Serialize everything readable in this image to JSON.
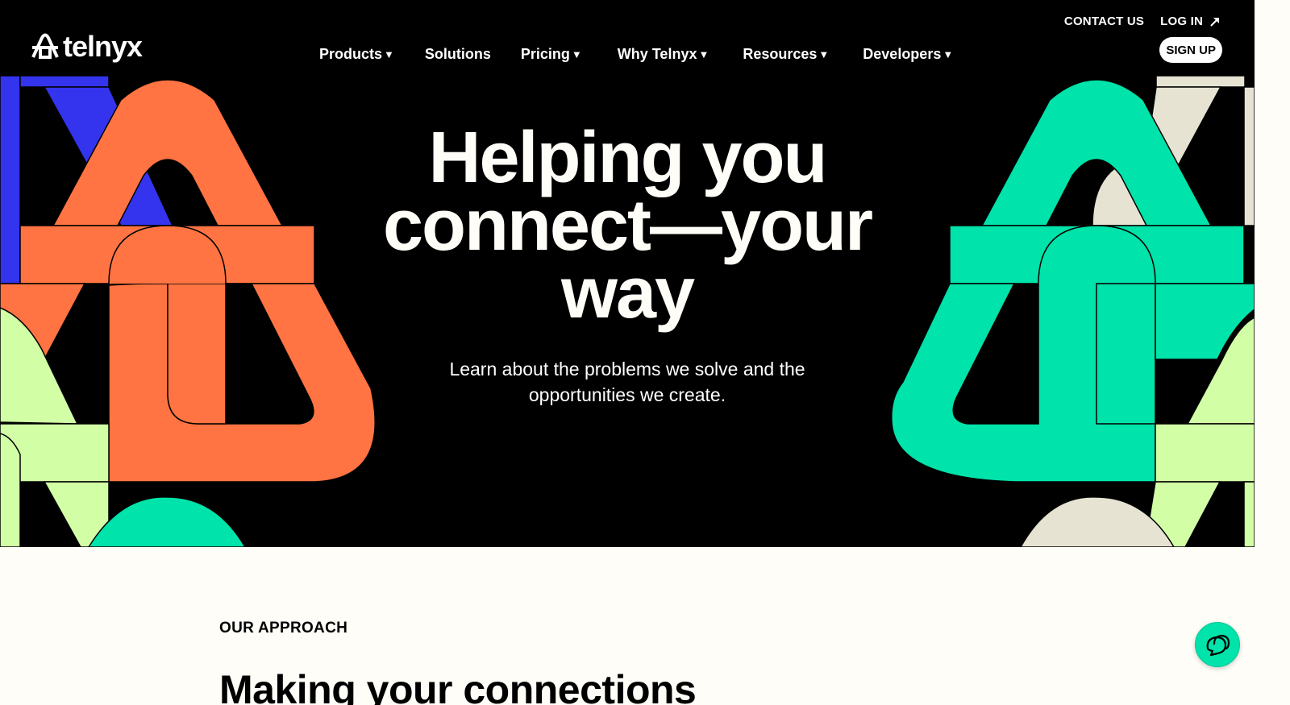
{
  "brand": {
    "name": "telnyx"
  },
  "header": {
    "utility_links": [
      {
        "label": "CONTACT US"
      },
      {
        "label": "LOG IN",
        "icon": "arrow-up-right-icon"
      }
    ],
    "nav": [
      {
        "label": "Products",
        "has_dropdown": true
      },
      {
        "label": "Solutions",
        "has_dropdown": false
      },
      {
        "label": "Pricing",
        "has_dropdown": true
      },
      {
        "label": "Why Telnyx",
        "has_dropdown": true
      },
      {
        "label": "Resources",
        "has_dropdown": true
      },
      {
        "label": "Developers",
        "has_dropdown": true
      }
    ],
    "caret": "▼",
    "signup_label": "SIGN UP"
  },
  "hero": {
    "title_lines": [
      "Helping you",
      "connect—your",
      "way"
    ],
    "subtitle_lines": [
      "Learn about the problems we solve and the",
      "opportunities we create."
    ]
  },
  "approach": {
    "eyebrow": "OUR APPROACH",
    "heading": "Making your connections"
  },
  "chat": {
    "icon": "chat-bubbles-icon"
  },
  "colors": {
    "background": "#000000",
    "page": "#fefdf7",
    "orange": "#ff7442",
    "blue": "#3434ef",
    "green": "#00e3aa",
    "lime": "#d2ffa6",
    "cream": "#e6e3d3"
  }
}
